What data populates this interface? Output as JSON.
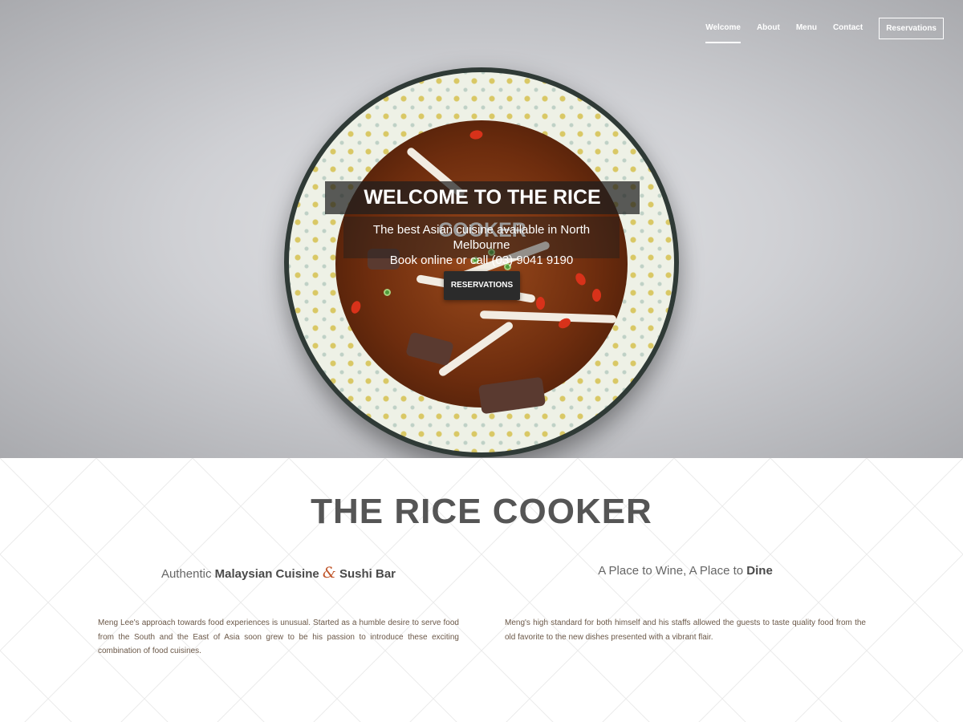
{
  "nav": {
    "items": [
      "Welcome",
      "About",
      "Menu",
      "Contact"
    ],
    "reservations_button": "Reservations",
    "active_item": "Welcome"
  },
  "hero": {
    "title": "WELCOME TO THE RICE COOKER",
    "subtitle_line1": "The best Asian cuisine available in North Melbourne",
    "subtitle_line2": "Book online or call (03) 9041 9190",
    "button": "RESERVATIONS"
  },
  "intro": {
    "title": "THE RICE COOKER",
    "left_tagline": {
      "prefix": "Authentic ",
      "bold1": "Malaysian Cuisine",
      "amp": "&",
      "bold2": "Sushi Bar"
    },
    "right_tagline": {
      "prefix": "A Place to Wine, A Place to ",
      "bold": "Dine"
    },
    "left_paragraph": "Meng Lee's approach towards food experiences is unusual. Started as a humble desire to serve food from the South and the East of Asia soon grew to be his passion to introduce these exciting combination of food cuisines.",
    "right_paragraph": "Meng's high standard for both himself and his staffs allowed the guests to taste quality food from the old favorite to the new dishes presented with a vibrant flair."
  },
  "colors": {
    "accent_ampersand": "#c0562b",
    "title_gray": "#555555",
    "body_text": "#6b5848",
    "button_dark": "#2b2b2b"
  }
}
